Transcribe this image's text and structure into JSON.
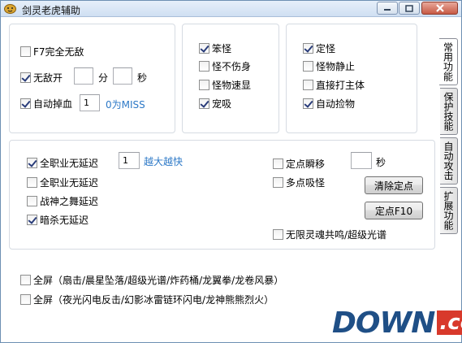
{
  "window": {
    "title": "剑灵老虎辅助"
  },
  "tabs": [
    {
      "label": "常用功能",
      "active": true
    },
    {
      "label": "保护技能",
      "active": false
    },
    {
      "label": "自动攻击",
      "active": false
    },
    {
      "label": "扩展功能",
      "active": false
    }
  ],
  "group1": {
    "f7": {
      "label": "F7完全无敌",
      "checked": false
    },
    "invincible": {
      "label": "无敌开",
      "checked": true
    },
    "minutes_value": "",
    "minutes_unit": "分",
    "seconds_value": "",
    "seconds_unit": "秒",
    "auto_drop": {
      "label": "自动掉血",
      "checked": true
    },
    "drop_value": "1",
    "drop_hint": "0为MISS"
  },
  "group2": {
    "items": [
      {
        "label": "笨怪",
        "checked": true
      },
      {
        "label": "怪不伤身",
        "checked": false
      },
      {
        "label": "怪物速显",
        "checked": false
      },
      {
        "label": "宠吸",
        "checked": true
      }
    ]
  },
  "group3": {
    "items": [
      {
        "label": "定怪",
        "checked": true
      },
      {
        "label": "怪物静止",
        "checked": false
      },
      {
        "label": "直接打主体",
        "checked": false
      },
      {
        "label": "自动捡物",
        "checked": true
      }
    ]
  },
  "group4": {
    "items": [
      {
        "label": "全职业无延迟",
        "checked": true
      },
      {
        "label": "全职业无延迟",
        "checked": false
      },
      {
        "label": "战神之舞延迟",
        "checked": false
      },
      {
        "label": "暗杀无延迟",
        "checked": true
      }
    ],
    "delay_value": "1",
    "delay_hint": "越大越快",
    "teleport": {
      "label": "定点瞬移",
      "checked": false
    },
    "teleport_seconds": "",
    "teleport_unit": "秒",
    "multi_pull": {
      "label": "多点吸怪",
      "checked": false
    },
    "clear_button": "清除定点",
    "setpoint_button": "定点F10",
    "resonance": {
      "label": "无限灵魂共鸣/超级光谱",
      "checked": false
    }
  },
  "fullscreen": [
    {
      "label": "全屏（扇击/晨星坠落/超级光谱/炸药桶/龙翼拳/龙卷风暴）",
      "checked": false
    },
    {
      "label": "全屏（夜光闪电反击/幻影冰雷链环闪电/龙神熊熊烈火）",
      "checked": false
    }
  ],
  "watermark": {
    "text": "DOWN",
    "suffix": ".cc"
  },
  "icons": {
    "app": "tiger-app-icon",
    "minimize": "minimize-icon",
    "maximize": "maximize-icon",
    "close": "close-icon"
  }
}
